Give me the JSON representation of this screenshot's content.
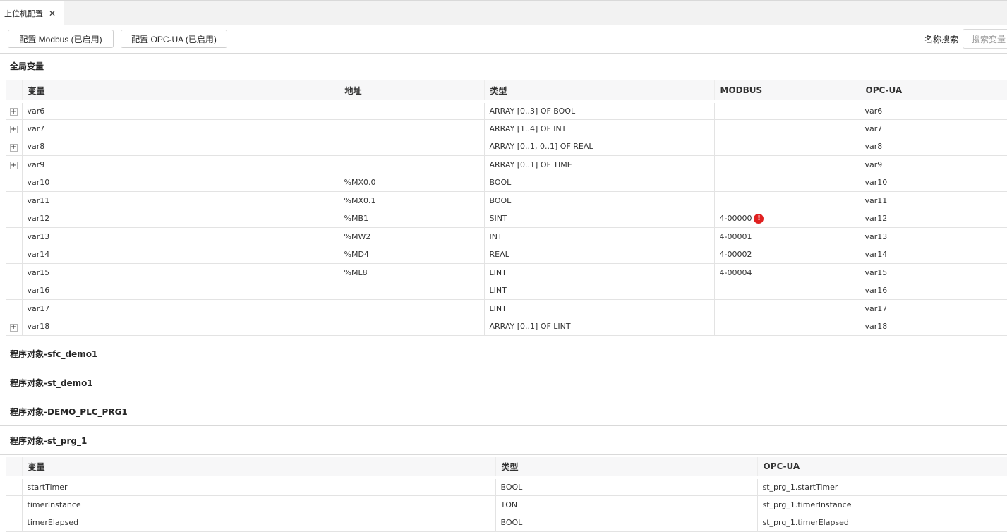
{
  "tab": {
    "label": "上位机配置"
  },
  "toolbar": {
    "modbus_button": "配置 Modbus (已启用)",
    "opcua_button": "配置 OPC-UA (已启用)",
    "search_label": "名称搜索",
    "search_placeholder": "搜索变量"
  },
  "global": {
    "title": "全局变量",
    "columns": [
      "变量",
      "地址",
      "类型",
      "MODBUS",
      "OPC-UA"
    ],
    "rows": [
      {
        "name": "var6",
        "address": "",
        "type": "ARRAY [0..3] OF BOOL",
        "modbus": "",
        "opcua": "var6",
        "expandable": true
      },
      {
        "name": "var7",
        "address": "",
        "type": "ARRAY [1..4] OF INT",
        "modbus": "",
        "opcua": "var7",
        "expandable": true
      },
      {
        "name": "var8",
        "address": "",
        "type": "ARRAY [0..1, 0..1] OF REAL",
        "modbus": "",
        "opcua": "var8",
        "expandable": true
      },
      {
        "name": "var9",
        "address": "",
        "type": "ARRAY [0..1] OF TIME",
        "modbus": "",
        "opcua": "var9",
        "expandable": true
      },
      {
        "name": "var10",
        "address": "%MX0.0",
        "type": "BOOL",
        "modbus": "",
        "opcua": "var10",
        "expandable": false
      },
      {
        "name": "var11",
        "address": "%MX0.1",
        "type": "BOOL",
        "modbus": "",
        "opcua": "var11",
        "expandable": false
      },
      {
        "name": "var12",
        "address": "%MB1",
        "type": "SINT",
        "modbus": "4-00000",
        "opcua": "var12",
        "expandable": false,
        "warning": true
      },
      {
        "name": "var13",
        "address": "%MW2",
        "type": "INT",
        "modbus": "4-00001",
        "opcua": "var13",
        "expandable": false
      },
      {
        "name": "var14",
        "address": "%MD4",
        "type": "REAL",
        "modbus": "4-00002",
        "opcua": "var14",
        "expandable": false
      },
      {
        "name": "var15",
        "address": "%ML8",
        "type": "LINT",
        "modbus": "4-00004",
        "opcua": "var15",
        "expandable": false
      },
      {
        "name": "var16",
        "address": "",
        "type": "LINT",
        "modbus": "",
        "opcua": "var16",
        "expandable": false
      },
      {
        "name": "var17",
        "address": "",
        "type": "LINT",
        "modbus": "",
        "opcua": "var17",
        "expandable": false
      },
      {
        "name": "var18",
        "address": "",
        "type": "ARRAY [0..1] OF LINT",
        "modbus": "",
        "opcua": "var18",
        "expandable": true
      }
    ]
  },
  "programs": [
    {
      "title": "程序对象-sfc_demo1"
    },
    {
      "title": "程序对象-st_demo1"
    },
    {
      "title": "程序对象-DEMO_PLC_PRG1"
    },
    {
      "title": "程序对象-st_prg_1"
    }
  ],
  "st_prg_1": {
    "columns": [
      "变量",
      "类型",
      "OPC-UA"
    ],
    "rows": [
      {
        "name": "startTimer",
        "type": "BOOL",
        "opcua": "st_prg_1.startTimer"
      },
      {
        "name": "timerInstance",
        "type": "TON",
        "opcua": "st_prg_1.timerInstance"
      },
      {
        "name": "timerElapsed",
        "type": "BOOL",
        "opcua": "st_prg_1.timerElapsed"
      }
    ]
  },
  "colors": {
    "warning": "#e02020",
    "header_bg": "#f7f7f8",
    "tabbar_bg": "#f2f2f2"
  },
  "icons": {
    "close": "close-icon",
    "expand": "plus-icon",
    "warning": "exclamation-circle-icon"
  }
}
